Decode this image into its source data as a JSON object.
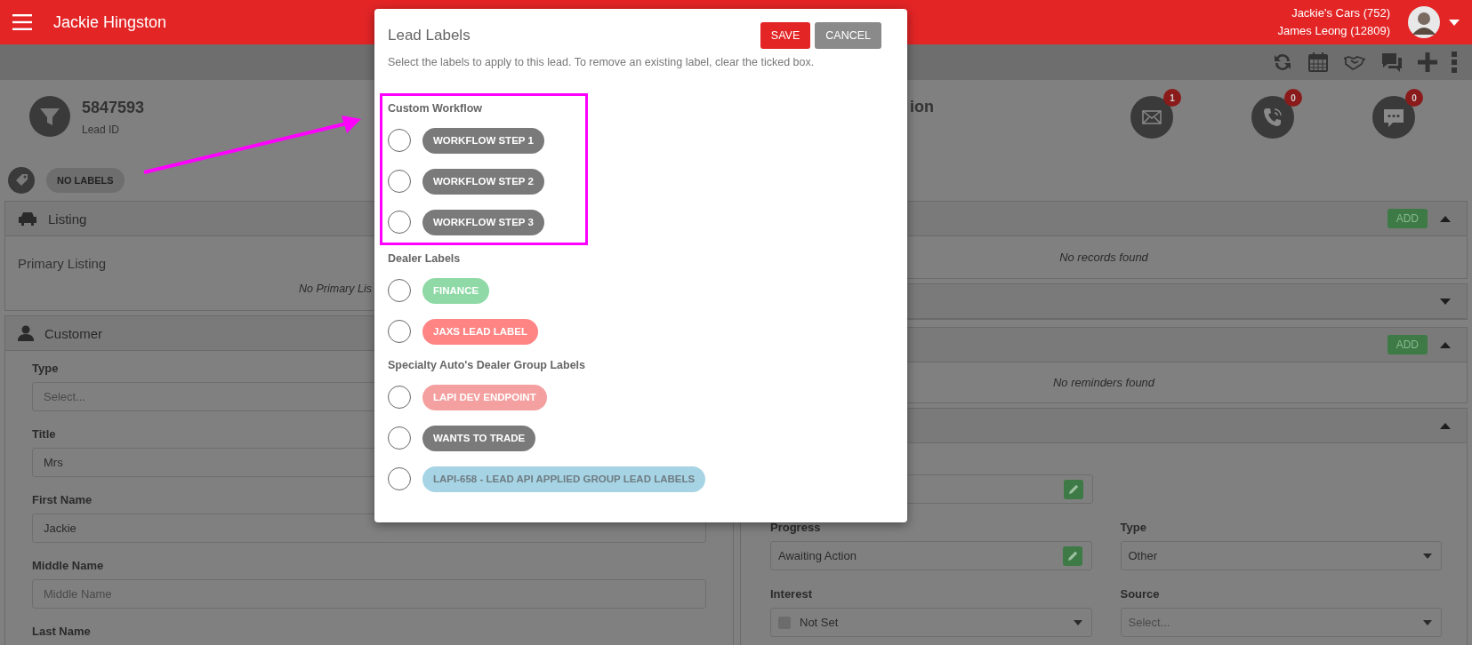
{
  "header": {
    "title": "Jackie Hingston",
    "account": "Jackie's Cars (752)",
    "user": "James Leong (12809)"
  },
  "lead": {
    "id": "5847593",
    "id_label": "Lead ID",
    "title_fragment": "ion",
    "counters": [
      {
        "kind": "email",
        "count": "1"
      },
      {
        "kind": "call",
        "count": "0"
      },
      {
        "kind": "message",
        "count": "0"
      }
    ]
  },
  "labels_bar": {
    "tag": "NO LABELS"
  },
  "listing": {
    "title": "Listing",
    "subtitle": "Primary Listing",
    "empty": "No Primary Lis"
  },
  "customer": {
    "title": "Customer",
    "fields": [
      {
        "label": "Type",
        "placeholder": "Select..."
      },
      {
        "label": "Title",
        "value": "Mrs"
      },
      {
        "label": "First Name",
        "value": "Jackie"
      },
      {
        "label": "Middle Name",
        "placeholder": "Middle Name"
      },
      {
        "label": "Last Name"
      }
    ]
  },
  "right_panels": [
    {
      "add": "ADD",
      "expanded": true,
      "empty": "No records found"
    },
    {
      "expanded": false
    },
    {
      "add": "ADD",
      "expanded": true,
      "empty": "No reminders found"
    },
    {
      "expanded": true
    }
  ],
  "details": {
    "rows": [
      {
        "fields": [
          {
            "kind": "edit"
          }
        ]
      },
      {
        "fields": [
          {
            "kind": "edit",
            "label": "Progress",
            "value": "Awaiting Action"
          },
          {
            "kind": "select",
            "label": "Type",
            "value": "Other"
          }
        ]
      },
      {
        "fields": [
          {
            "kind": "select",
            "label": "Interest",
            "value": "Not Set",
            "color": "#6c6c6c"
          },
          {
            "kind": "select",
            "label": "Source",
            "placeholder": "Select..."
          }
        ]
      }
    ]
  },
  "modal": {
    "title": "Lead Labels",
    "buttons": [
      {
        "label": "SAVE",
        "kind": "primary"
      },
      {
        "label": "CANCEL",
        "kind": "secondary"
      }
    ],
    "description": "Select the labels to apply to this lead. To remove an existing label, clear the ticked box.",
    "groups": [
      {
        "title": "Custom Workflow",
        "highlighted": true,
        "labels": [
          {
            "text": "WORKFLOW STEP 1",
            "color": "#7a7a7a",
            "disabled": false,
            "checked": false
          },
          {
            "text": "WORKFLOW STEP 2",
            "color": "#7a7a7a",
            "disabled": false,
            "checked": false
          },
          {
            "text": "WORKFLOW STEP 3",
            "color": "#7a7a7a",
            "disabled": false,
            "checked": false
          }
        ]
      },
      {
        "title": "Dealer Labels",
        "highlighted": false,
        "labels": [
          {
            "text": "FINANCE",
            "color": "#8ed9a6",
            "disabled": false,
            "checked": false
          },
          {
            "text": "JAXS LEAD LABEL",
            "color": "#ff8585",
            "disabled": false,
            "checked": false
          }
        ]
      },
      {
        "title": "Specialty Auto's Dealer Group Labels",
        "highlighted": false,
        "labels": [
          {
            "text": "LAPI DEV ENDPOINT",
            "color": "#f4a0a0",
            "disabled": false,
            "checked": false
          },
          {
            "text": "WANTS TO TRADE",
            "color": "#7a7a7a",
            "disabled": false,
            "checked": false
          },
          {
            "text": "LAPI-658 - LEAD API APPLIED GROUP LEAD LABELS",
            "color": "#a6d4e4",
            "disabled": true,
            "checked": false
          }
        ]
      }
    ]
  }
}
